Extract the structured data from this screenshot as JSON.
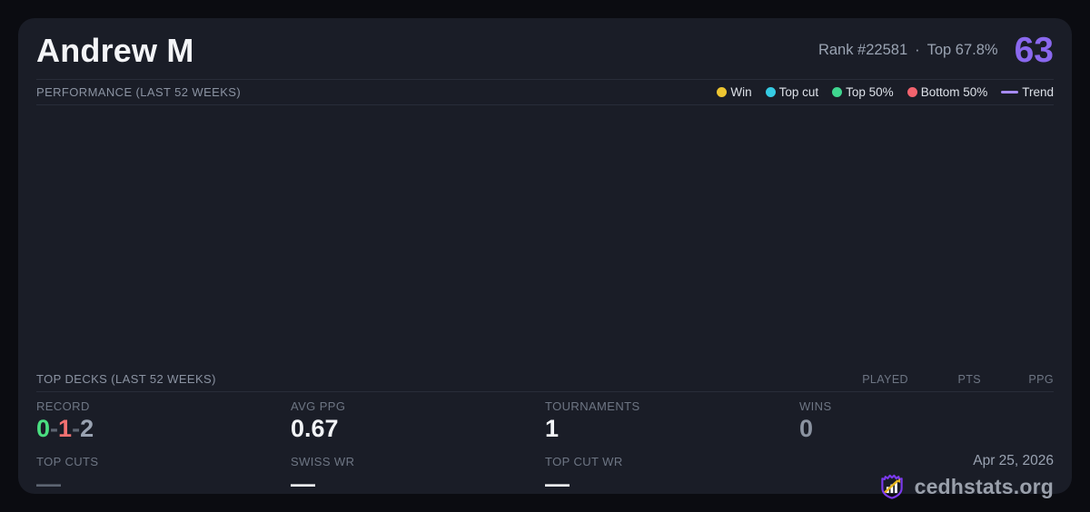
{
  "header": {
    "player_name": "Andrew M",
    "rank_text": "Rank #22581",
    "separator": "·",
    "top_percent": "Top 67.8%",
    "score": "63"
  },
  "performance": {
    "title": "PERFORMANCE (LAST 52 WEEKS)",
    "legend": [
      {
        "label": "Win",
        "color": "#edc531",
        "marker": "dot"
      },
      {
        "label": "Top cut",
        "color": "#35cbe3",
        "marker": "dot"
      },
      {
        "label": "Top 50%",
        "color": "#3fd68f",
        "marker": "dot"
      },
      {
        "label": "Bottom 50%",
        "color": "#f2636e",
        "marker": "dot"
      },
      {
        "label": "Trend",
        "color": "#a78bfa",
        "marker": "line"
      }
    ],
    "chart_empty": true
  },
  "top_decks": {
    "title": "TOP DECKS (LAST 52 WEEKS)",
    "columns": [
      "PLAYED",
      "PTS",
      "PPG"
    ],
    "rows": []
  },
  "stats": {
    "record": {
      "label": "RECORD",
      "wins": "0",
      "losses": "1",
      "draws": "2",
      "sep": "-"
    },
    "avg_ppg": {
      "label": "AVG PPG",
      "value": "0.67"
    },
    "tournaments": {
      "label": "TOURNAMENTS",
      "value": "1"
    },
    "wins": {
      "label": "WINS",
      "value": "0"
    },
    "top_cuts": {
      "label": "TOP CUTS",
      "value": "—"
    },
    "swiss_wr": {
      "label": "SWISS WR",
      "value": "—"
    },
    "top_cut_wr": {
      "label": "TOP CUT WR",
      "value": "—"
    }
  },
  "footer": {
    "date": "Apr 25, 2026",
    "brand": "cedhstats.org"
  },
  "colors": {
    "page_bg": "#0b0c11",
    "card_bg": "#1a1d27",
    "divider": "#282c39",
    "accent_purple": "#8a68ee",
    "logo_purple": "#7c3aed",
    "logo_gold": "#e8b81e",
    "record_win_green": "#4ade80",
    "record_loss_red": "#f47171"
  }
}
